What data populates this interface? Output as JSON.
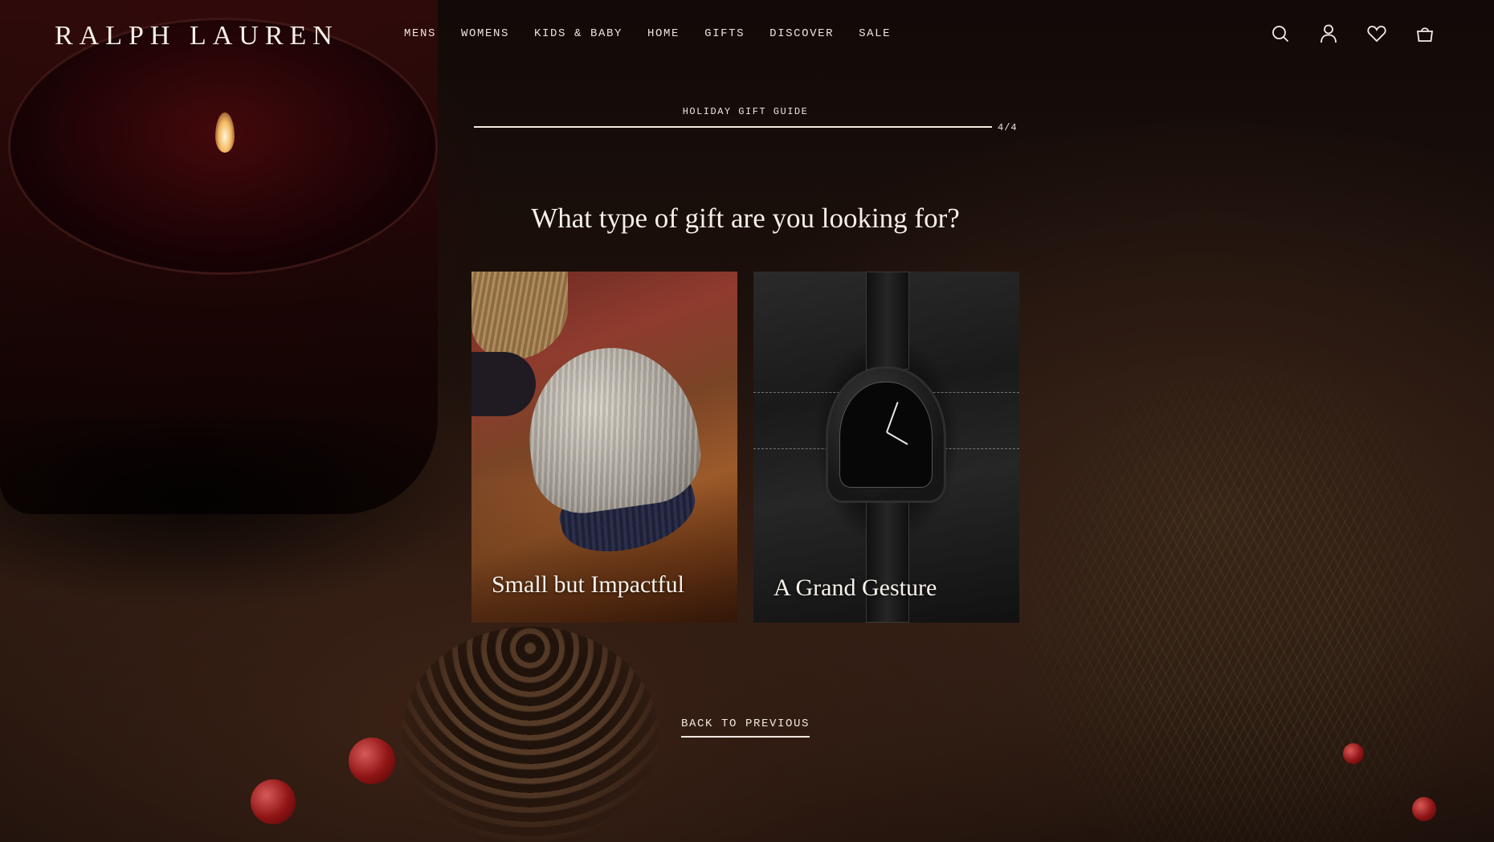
{
  "brand": {
    "logo_text": "RALPH LAUREN"
  },
  "nav": {
    "items": [
      "MENS",
      "WOMENS",
      "KIDS & BABY",
      "HOME",
      "GIFTS",
      "DISCOVER",
      "SALE"
    ]
  },
  "header_icons": [
    "search-icon",
    "account-icon",
    "wishlist-heart-icon",
    "shopping-bag-icon"
  ],
  "quiz": {
    "eyebrow": "HOLIDAY GIFT GUIDE",
    "progress_count": "4/4",
    "progress_fraction": 1.0,
    "question": "What type of gift are you looking for?",
    "options": [
      {
        "title": "Small but Impactful"
      },
      {
        "title": "A Grand Gesture"
      }
    ],
    "back_label": "BACK TO PREVIOUS"
  },
  "colors": {
    "text": "#f3ece4",
    "background": "#1a0f0a",
    "accent": "#8e1414"
  }
}
